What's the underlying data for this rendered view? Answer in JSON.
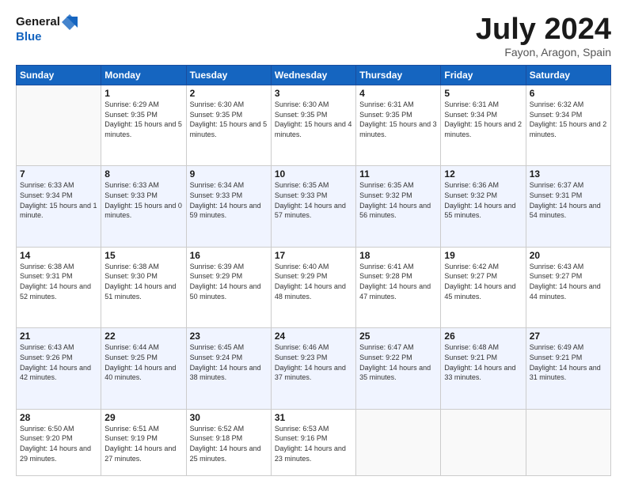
{
  "logo": {
    "general": "General",
    "blue": "Blue"
  },
  "header": {
    "month": "July 2024",
    "location": "Fayon, Aragon, Spain"
  },
  "weekdays": [
    "Sunday",
    "Monday",
    "Tuesday",
    "Wednesday",
    "Thursday",
    "Friday",
    "Saturday"
  ],
  "weeks": [
    [
      {
        "day": "",
        "sunrise": "",
        "sunset": "",
        "daylight": ""
      },
      {
        "day": "1",
        "sunrise": "Sunrise: 6:29 AM",
        "sunset": "Sunset: 9:35 PM",
        "daylight": "Daylight: 15 hours and 5 minutes."
      },
      {
        "day": "2",
        "sunrise": "Sunrise: 6:30 AM",
        "sunset": "Sunset: 9:35 PM",
        "daylight": "Daylight: 15 hours and 5 minutes."
      },
      {
        "day": "3",
        "sunrise": "Sunrise: 6:30 AM",
        "sunset": "Sunset: 9:35 PM",
        "daylight": "Daylight: 15 hours and 4 minutes."
      },
      {
        "day": "4",
        "sunrise": "Sunrise: 6:31 AM",
        "sunset": "Sunset: 9:35 PM",
        "daylight": "Daylight: 15 hours and 3 minutes."
      },
      {
        "day": "5",
        "sunrise": "Sunrise: 6:31 AM",
        "sunset": "Sunset: 9:34 PM",
        "daylight": "Daylight: 15 hours and 2 minutes."
      },
      {
        "day": "6",
        "sunrise": "Sunrise: 6:32 AM",
        "sunset": "Sunset: 9:34 PM",
        "daylight": "Daylight: 15 hours and 2 minutes."
      }
    ],
    [
      {
        "day": "7",
        "sunrise": "Sunrise: 6:33 AM",
        "sunset": "Sunset: 9:34 PM",
        "daylight": "Daylight: 15 hours and 1 minute."
      },
      {
        "day": "8",
        "sunrise": "Sunrise: 6:33 AM",
        "sunset": "Sunset: 9:33 PM",
        "daylight": "Daylight: 15 hours and 0 minutes."
      },
      {
        "day": "9",
        "sunrise": "Sunrise: 6:34 AM",
        "sunset": "Sunset: 9:33 PM",
        "daylight": "Daylight: 14 hours and 59 minutes."
      },
      {
        "day": "10",
        "sunrise": "Sunrise: 6:35 AM",
        "sunset": "Sunset: 9:33 PM",
        "daylight": "Daylight: 14 hours and 57 minutes."
      },
      {
        "day": "11",
        "sunrise": "Sunrise: 6:35 AM",
        "sunset": "Sunset: 9:32 PM",
        "daylight": "Daylight: 14 hours and 56 minutes."
      },
      {
        "day": "12",
        "sunrise": "Sunrise: 6:36 AM",
        "sunset": "Sunset: 9:32 PM",
        "daylight": "Daylight: 14 hours and 55 minutes."
      },
      {
        "day": "13",
        "sunrise": "Sunrise: 6:37 AM",
        "sunset": "Sunset: 9:31 PM",
        "daylight": "Daylight: 14 hours and 54 minutes."
      }
    ],
    [
      {
        "day": "14",
        "sunrise": "Sunrise: 6:38 AM",
        "sunset": "Sunset: 9:31 PM",
        "daylight": "Daylight: 14 hours and 52 minutes."
      },
      {
        "day": "15",
        "sunrise": "Sunrise: 6:38 AM",
        "sunset": "Sunset: 9:30 PM",
        "daylight": "Daylight: 14 hours and 51 minutes."
      },
      {
        "day": "16",
        "sunrise": "Sunrise: 6:39 AM",
        "sunset": "Sunset: 9:29 PM",
        "daylight": "Daylight: 14 hours and 50 minutes."
      },
      {
        "day": "17",
        "sunrise": "Sunrise: 6:40 AM",
        "sunset": "Sunset: 9:29 PM",
        "daylight": "Daylight: 14 hours and 48 minutes."
      },
      {
        "day": "18",
        "sunrise": "Sunrise: 6:41 AM",
        "sunset": "Sunset: 9:28 PM",
        "daylight": "Daylight: 14 hours and 47 minutes."
      },
      {
        "day": "19",
        "sunrise": "Sunrise: 6:42 AM",
        "sunset": "Sunset: 9:27 PM",
        "daylight": "Daylight: 14 hours and 45 minutes."
      },
      {
        "day": "20",
        "sunrise": "Sunrise: 6:43 AM",
        "sunset": "Sunset: 9:27 PM",
        "daylight": "Daylight: 14 hours and 44 minutes."
      }
    ],
    [
      {
        "day": "21",
        "sunrise": "Sunrise: 6:43 AM",
        "sunset": "Sunset: 9:26 PM",
        "daylight": "Daylight: 14 hours and 42 minutes."
      },
      {
        "day": "22",
        "sunrise": "Sunrise: 6:44 AM",
        "sunset": "Sunset: 9:25 PM",
        "daylight": "Daylight: 14 hours and 40 minutes."
      },
      {
        "day": "23",
        "sunrise": "Sunrise: 6:45 AM",
        "sunset": "Sunset: 9:24 PM",
        "daylight": "Daylight: 14 hours and 38 minutes."
      },
      {
        "day": "24",
        "sunrise": "Sunrise: 6:46 AM",
        "sunset": "Sunset: 9:23 PM",
        "daylight": "Daylight: 14 hours and 37 minutes."
      },
      {
        "day": "25",
        "sunrise": "Sunrise: 6:47 AM",
        "sunset": "Sunset: 9:22 PM",
        "daylight": "Daylight: 14 hours and 35 minutes."
      },
      {
        "day": "26",
        "sunrise": "Sunrise: 6:48 AM",
        "sunset": "Sunset: 9:21 PM",
        "daylight": "Daylight: 14 hours and 33 minutes."
      },
      {
        "day": "27",
        "sunrise": "Sunrise: 6:49 AM",
        "sunset": "Sunset: 9:21 PM",
        "daylight": "Daylight: 14 hours and 31 minutes."
      }
    ],
    [
      {
        "day": "28",
        "sunrise": "Sunrise: 6:50 AM",
        "sunset": "Sunset: 9:20 PM",
        "daylight": "Daylight: 14 hours and 29 minutes."
      },
      {
        "day": "29",
        "sunrise": "Sunrise: 6:51 AM",
        "sunset": "Sunset: 9:19 PM",
        "daylight": "Daylight: 14 hours and 27 minutes."
      },
      {
        "day": "30",
        "sunrise": "Sunrise: 6:52 AM",
        "sunset": "Sunset: 9:18 PM",
        "daylight": "Daylight: 14 hours and 25 minutes."
      },
      {
        "day": "31",
        "sunrise": "Sunrise: 6:53 AM",
        "sunset": "Sunset: 9:16 PM",
        "daylight": "Daylight: 14 hours and 23 minutes."
      },
      {
        "day": "",
        "sunrise": "",
        "sunset": "",
        "daylight": ""
      },
      {
        "day": "",
        "sunrise": "",
        "sunset": "",
        "daylight": ""
      },
      {
        "day": "",
        "sunrise": "",
        "sunset": "",
        "daylight": ""
      }
    ]
  ]
}
